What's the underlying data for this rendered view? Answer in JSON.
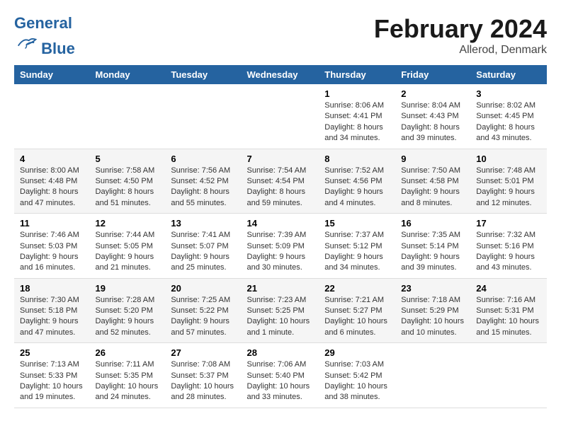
{
  "header": {
    "logo_text_general": "General",
    "logo_text_blue": "Blue",
    "main_title": "February 2024",
    "subtitle": "Allerod, Denmark"
  },
  "calendar": {
    "headers": [
      "Sunday",
      "Monday",
      "Tuesday",
      "Wednesday",
      "Thursday",
      "Friday",
      "Saturday"
    ],
    "weeks": [
      [
        {
          "day": "",
          "info": ""
        },
        {
          "day": "",
          "info": ""
        },
        {
          "day": "",
          "info": ""
        },
        {
          "day": "",
          "info": ""
        },
        {
          "day": "1",
          "info": "Sunrise: 8:06 AM\nSunset: 4:41 PM\nDaylight: 8 hours\nand 34 minutes."
        },
        {
          "day": "2",
          "info": "Sunrise: 8:04 AM\nSunset: 4:43 PM\nDaylight: 8 hours\nand 39 minutes."
        },
        {
          "day": "3",
          "info": "Sunrise: 8:02 AM\nSunset: 4:45 PM\nDaylight: 8 hours\nand 43 minutes."
        }
      ],
      [
        {
          "day": "4",
          "info": "Sunrise: 8:00 AM\nSunset: 4:48 PM\nDaylight: 8 hours\nand 47 minutes."
        },
        {
          "day": "5",
          "info": "Sunrise: 7:58 AM\nSunset: 4:50 PM\nDaylight: 8 hours\nand 51 minutes."
        },
        {
          "day": "6",
          "info": "Sunrise: 7:56 AM\nSunset: 4:52 PM\nDaylight: 8 hours\nand 55 minutes."
        },
        {
          "day": "7",
          "info": "Sunrise: 7:54 AM\nSunset: 4:54 PM\nDaylight: 8 hours\nand 59 minutes."
        },
        {
          "day": "8",
          "info": "Sunrise: 7:52 AM\nSunset: 4:56 PM\nDaylight: 9 hours\nand 4 minutes."
        },
        {
          "day": "9",
          "info": "Sunrise: 7:50 AM\nSunset: 4:58 PM\nDaylight: 9 hours\nand 8 minutes."
        },
        {
          "day": "10",
          "info": "Sunrise: 7:48 AM\nSunset: 5:01 PM\nDaylight: 9 hours\nand 12 minutes."
        }
      ],
      [
        {
          "day": "11",
          "info": "Sunrise: 7:46 AM\nSunset: 5:03 PM\nDaylight: 9 hours\nand 16 minutes."
        },
        {
          "day": "12",
          "info": "Sunrise: 7:44 AM\nSunset: 5:05 PM\nDaylight: 9 hours\nand 21 minutes."
        },
        {
          "day": "13",
          "info": "Sunrise: 7:41 AM\nSunset: 5:07 PM\nDaylight: 9 hours\nand 25 minutes."
        },
        {
          "day": "14",
          "info": "Sunrise: 7:39 AM\nSunset: 5:09 PM\nDaylight: 9 hours\nand 30 minutes."
        },
        {
          "day": "15",
          "info": "Sunrise: 7:37 AM\nSunset: 5:12 PM\nDaylight: 9 hours\nand 34 minutes."
        },
        {
          "day": "16",
          "info": "Sunrise: 7:35 AM\nSunset: 5:14 PM\nDaylight: 9 hours\nand 39 minutes."
        },
        {
          "day": "17",
          "info": "Sunrise: 7:32 AM\nSunset: 5:16 PM\nDaylight: 9 hours\nand 43 minutes."
        }
      ],
      [
        {
          "day": "18",
          "info": "Sunrise: 7:30 AM\nSunset: 5:18 PM\nDaylight: 9 hours\nand 47 minutes."
        },
        {
          "day": "19",
          "info": "Sunrise: 7:28 AM\nSunset: 5:20 PM\nDaylight: 9 hours\nand 52 minutes."
        },
        {
          "day": "20",
          "info": "Sunrise: 7:25 AM\nSunset: 5:22 PM\nDaylight: 9 hours\nand 57 minutes."
        },
        {
          "day": "21",
          "info": "Sunrise: 7:23 AM\nSunset: 5:25 PM\nDaylight: 10 hours\nand 1 minute."
        },
        {
          "day": "22",
          "info": "Sunrise: 7:21 AM\nSunset: 5:27 PM\nDaylight: 10 hours\nand 6 minutes."
        },
        {
          "day": "23",
          "info": "Sunrise: 7:18 AM\nSunset: 5:29 PM\nDaylight: 10 hours\nand 10 minutes."
        },
        {
          "day": "24",
          "info": "Sunrise: 7:16 AM\nSunset: 5:31 PM\nDaylight: 10 hours\nand 15 minutes."
        }
      ],
      [
        {
          "day": "25",
          "info": "Sunrise: 7:13 AM\nSunset: 5:33 PM\nDaylight: 10 hours\nand 19 minutes."
        },
        {
          "day": "26",
          "info": "Sunrise: 7:11 AM\nSunset: 5:35 PM\nDaylight: 10 hours\nand 24 minutes."
        },
        {
          "day": "27",
          "info": "Sunrise: 7:08 AM\nSunset: 5:37 PM\nDaylight: 10 hours\nand 28 minutes."
        },
        {
          "day": "28",
          "info": "Sunrise: 7:06 AM\nSunset: 5:40 PM\nDaylight: 10 hours\nand 33 minutes."
        },
        {
          "day": "29",
          "info": "Sunrise: 7:03 AM\nSunset: 5:42 PM\nDaylight: 10 hours\nand 38 minutes."
        },
        {
          "day": "",
          "info": ""
        },
        {
          "day": "",
          "info": ""
        }
      ]
    ]
  }
}
